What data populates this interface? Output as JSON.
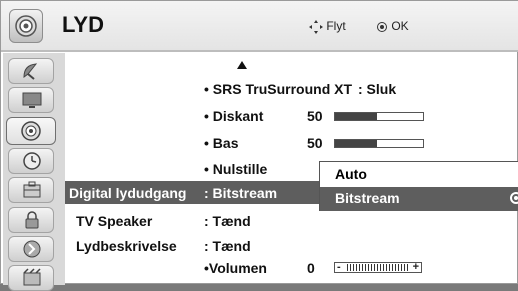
{
  "header": {
    "title": "LYD",
    "hint_move": "Flyt",
    "hint_ok": "OK",
    "icon": "speaker-icon"
  },
  "sidebar": {
    "items": [
      {
        "icon": "satellite-dish-icon",
        "active": false
      },
      {
        "icon": "picture-screen-icon",
        "active": false
      },
      {
        "icon": "speaker-icon",
        "active": true
      },
      {
        "icon": "clock-icon",
        "active": false
      },
      {
        "icon": "options-box-icon",
        "active": false
      },
      {
        "icon": "lock-icon",
        "active": false
      },
      {
        "icon": "network-icon",
        "active": false
      },
      {
        "icon": "media-icon",
        "active": false
      }
    ]
  },
  "menu": {
    "srs": {
      "label": "• SRS TruSurround XT",
      "value": ": Sluk"
    },
    "treble": {
      "label": "• Diskant",
      "value": "50",
      "level": 50
    },
    "bass": {
      "label": "• Bas",
      "value": "50",
      "level": 50
    },
    "reset": {
      "label": "• Nulstille"
    },
    "digital_out": {
      "label": "Digital lydudgang",
      "value": ": Bitstream"
    },
    "tv_speaker": {
      "label": "TV Speaker",
      "value": ": Tænd"
    },
    "audio_desc": {
      "label": "Lydbeskrivelse",
      "value": ": Tænd"
    },
    "volume": {
      "label": "•Volumen",
      "value": "0",
      "minus": "-",
      "plus": "+"
    }
  },
  "popup": {
    "options": [
      "Auto",
      "Bitstream"
    ],
    "selected": "Bitstream"
  },
  "colors": {
    "selection": "#5e5e5e",
    "header_bg": "#ececec",
    "sidebar_bg": "#d9d9d9"
  }
}
